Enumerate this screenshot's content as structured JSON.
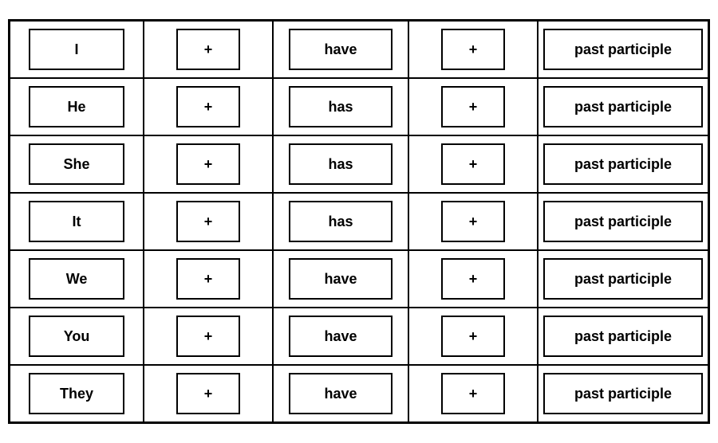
{
  "rows": [
    {
      "subject": "I",
      "verb": "have"
    },
    {
      "subject": "He",
      "verb": "has"
    },
    {
      "subject": "She",
      "verb": "has"
    },
    {
      "subject": "It",
      "verb": "has"
    },
    {
      "subject": "We",
      "verb": "have"
    },
    {
      "subject": "You",
      "verb": "have"
    },
    {
      "subject": "They",
      "verb": "have"
    }
  ],
  "plus": "+",
  "participle": "past participle"
}
